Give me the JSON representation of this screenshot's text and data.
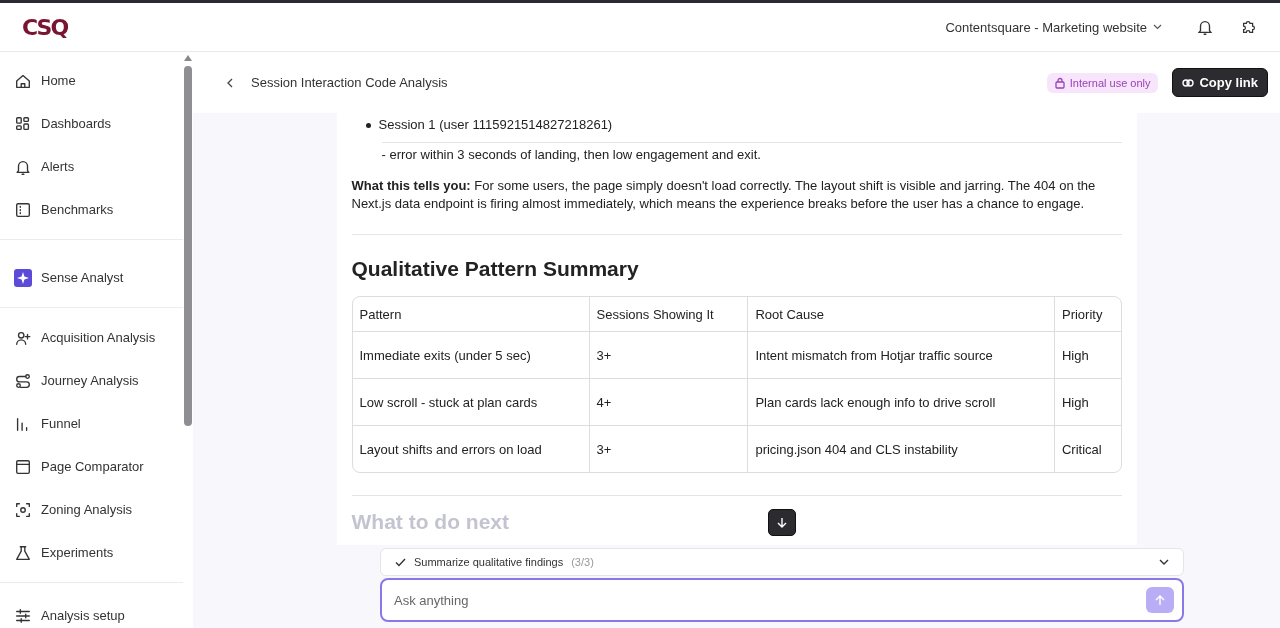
{
  "topbar": {
    "logo": "CSQ",
    "project": "Contentsquare - Marketing website"
  },
  "sidebar": {
    "groups": [
      [
        {
          "label": "Home",
          "selected": false
        },
        {
          "label": "Dashboards",
          "selected": false
        },
        {
          "label": "Alerts",
          "selected": false
        },
        {
          "label": "Benchmarks",
          "selected": false
        }
      ],
      [
        {
          "label": "Sense Analyst",
          "selected": false
        }
      ],
      [
        {
          "label": "Acquisition Analysis",
          "selected": false
        },
        {
          "label": "Journey Analysis",
          "selected": false
        },
        {
          "label": "Funnel",
          "selected": false
        },
        {
          "label": "Page Comparator",
          "selected": false
        },
        {
          "label": "Zoning Analysis",
          "selected": false
        },
        {
          "label": "Experiments",
          "selected": false
        }
      ]
    ],
    "footer_item": "Analysis setup"
  },
  "header": {
    "title": "Session Interaction Code Analysis",
    "badge": "Internal use only",
    "copy_button": "Copy link"
  },
  "content": {
    "bullet": "Session 1 (user 1115921514827218261)",
    "bullet_detail": "- error within 3 seconds of landing, then low engagement and exit.",
    "paragraph": "**What this tells you:** For some users, the page simply doesn't load correctly. The layout shift is visible and jarring. The 404 on the Next.js data endpoint is firing almost immediately, which means the experience breaks before the user has a chance to engage.",
    "heading": "Qualitative Pattern Summary",
    "table": {
      "columns": [
        "Pattern",
        "Sessions Showing It",
        "Root Cause",
        "Priority"
      ],
      "rows": [
        [
          "Immediate exits (under 5 sec)",
          "3+",
          "Intent mismatch from Hotjar traffic source",
          "High"
        ],
        [
          "Low scroll - stuck at plan cards",
          "4+",
          "Plan cards lack enough info to drive scroll",
          "High"
        ],
        [
          "Layout shifts and errors on load",
          "3+",
          "pricing.json 404 and CLS instability",
          "Critical"
        ]
      ]
    },
    "next_heading": "What to do next"
  },
  "steps": {
    "label": "Summarize qualitative findings",
    "count": "(3/3)",
    "done": true
  },
  "composer": {
    "placeholder": "Ask anything"
  }
}
